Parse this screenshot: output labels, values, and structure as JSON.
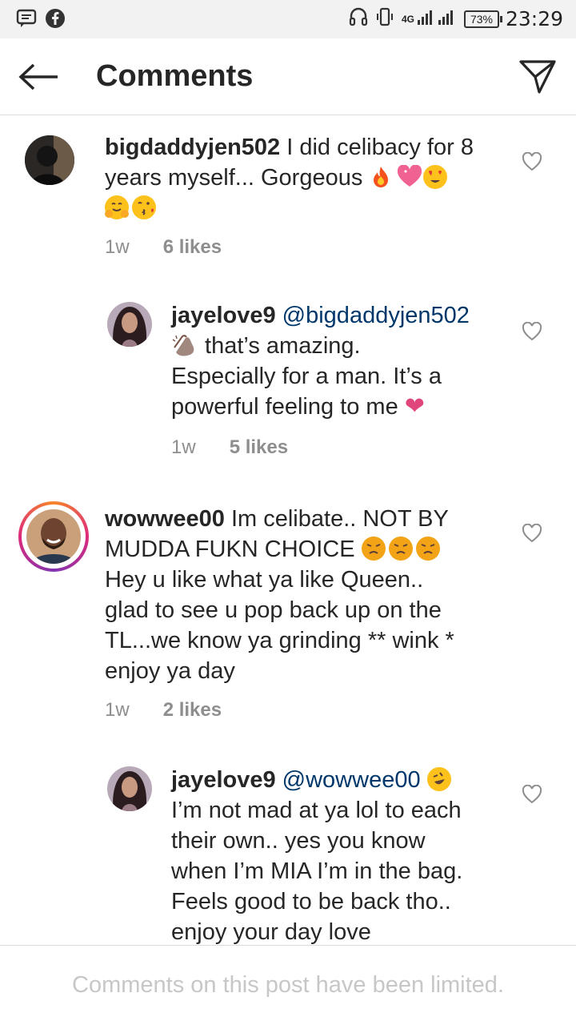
{
  "status_bar": {
    "network": "4G",
    "battery": "73%",
    "time": "23:29"
  },
  "header": {
    "title": "Comments"
  },
  "comments": [
    {
      "user": "bigdaddyjen502",
      "text_line1": " I did celibacy for 8",
      "text_line2": "years myself... Gorgeous ",
      "time": "1w",
      "likes": "6 likes"
    },
    {
      "user": "jayelove9",
      "mention": "@bigdaddyjen502",
      "text_line1": " that’s amazing.",
      "text_line2": "Especially for a man. It’s a",
      "text_line3": "powerful feeling to me ",
      "time": "1w",
      "likes": "5 likes"
    },
    {
      "user": "wowwee00",
      "text_line1": " Im celibate.. NOT BY",
      "text_line2": "MUDDA FUKN CHOICE ",
      "text_line3": "Hey u like what ya like Queen..",
      "text_line4": "glad to see u pop back up on the",
      "text_line5": "TL...we know ya grinding ** wink *",
      "text_line6": "enjoy ya day",
      "time": "1w",
      "likes": "2 likes"
    },
    {
      "user": "jayelove9",
      "mention": "@wowwee00",
      "text_line1": "I’m not mad at ya lol to each",
      "text_line2": "their own.. yes you know",
      "text_line3": "when I’m MIA I’m in the bag.",
      "text_line4": "Feels good to be back tho..",
      "text_line5": "enjoy your day love"
    }
  ],
  "footer": {
    "notice": "Comments on this post have been limited."
  },
  "colors": {
    "mention": "#00376b",
    "muted": "#8e8e8e",
    "heart": "#e0467c",
    "story_ring": "#e1306c"
  }
}
